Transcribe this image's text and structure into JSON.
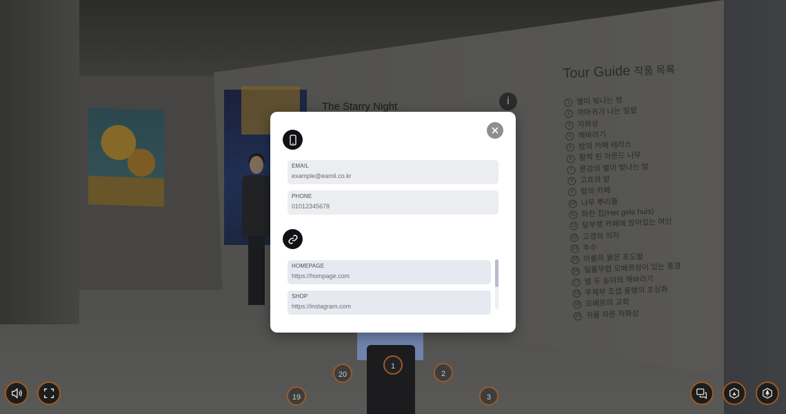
{
  "scene": {
    "painting_title": "The Starry Night",
    "info_icon_label": "i"
  },
  "tour_guide": {
    "title": "Tour Guide",
    "title_suffix": "작품 목록",
    "items": [
      {
        "n": "1",
        "label": "별이 빛나는 밤"
      },
      {
        "n": "2",
        "label": "까마귀가 나는 밀밭"
      },
      {
        "n": "3",
        "label": "자화상"
      },
      {
        "n": "4",
        "label": "해바라기"
      },
      {
        "n": "5",
        "label": "밤의 카페 테라스"
      },
      {
        "n": "6",
        "label": "활짝 핀 아몬드 나무"
      },
      {
        "n": "7",
        "label": "론강의 별이 빛나는 밤"
      },
      {
        "n": "8",
        "label": "고흐의 방"
      },
      {
        "n": "9",
        "label": "밤의 카페"
      },
      {
        "n": "10",
        "label": "나무 뿌리들"
      },
      {
        "n": "11",
        "label": "파란 집(Het gele huis)"
      },
      {
        "n": "12",
        "label": "탕부랭 카페에 앉아있는 여인"
      },
      {
        "n": "13",
        "label": "고갱의 의자"
      },
      {
        "n": "14",
        "label": "추수"
      },
      {
        "n": "15",
        "label": "아를의 붉은 포도밭"
      },
      {
        "n": "16",
        "label": "일몰무렵 오베르성이 있는 풍경"
      },
      {
        "n": "17",
        "label": "열 두 송이의 해바라기"
      },
      {
        "n": "18",
        "label": "우체부 조셉 룰랭의 초상화"
      },
      {
        "n": "19",
        "label": "오베르의 교회"
      },
      {
        "n": "20",
        "label": "귀를 자른 자화상"
      }
    ]
  },
  "modal": {
    "contact": {
      "email_label": "EMAIL",
      "email_value": "example@eamil.co.kr",
      "phone_label": "PHONE",
      "phone_value": "01012345678"
    },
    "links": {
      "homepage_label": "HOMEPAGE",
      "homepage_value": "https://hompage.com",
      "shop_label": "SHOP",
      "shop_value": "https://instagram.com"
    }
  },
  "hotspots": {
    "h1": "1",
    "h2": "2",
    "h3": "3",
    "h19": "19",
    "h20": "20"
  },
  "controls": {
    "left": [
      "speaker-icon",
      "fullscreen-icon"
    ],
    "right": [
      "chat-icon",
      "view-icon",
      "map-icon"
    ],
    "accent_color": "#a15a21"
  }
}
